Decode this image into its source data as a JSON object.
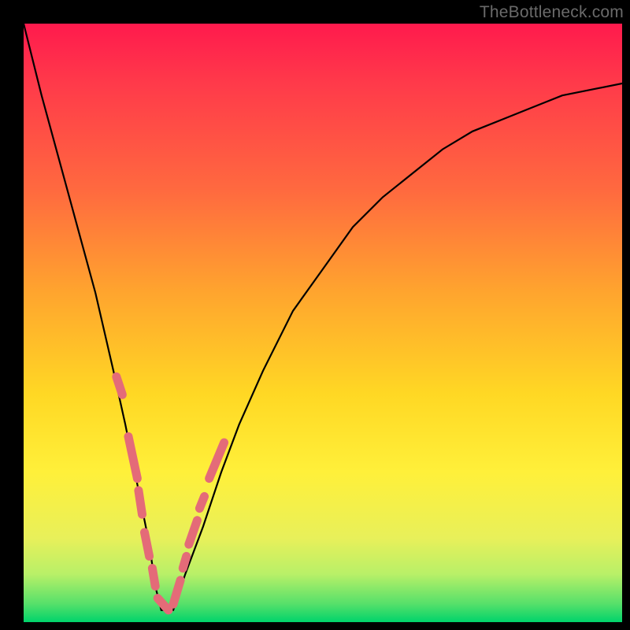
{
  "watermark": "TheBottleneck.com",
  "chart_data": {
    "type": "line",
    "title": "",
    "xlabel": "",
    "ylabel": "",
    "xlim": [
      0,
      100
    ],
    "ylim": [
      0,
      100
    ],
    "grid": false,
    "legend": false,
    "series": [
      {
        "name": "bottleneck-curve",
        "x": [
          0,
          3,
          6,
          9,
          12,
          15,
          17,
          19,
          21,
          22,
          23,
          25,
          27,
          30,
          33,
          36,
          40,
          45,
          50,
          55,
          60,
          65,
          70,
          75,
          80,
          85,
          90,
          95,
          100
        ],
        "y": [
          100,
          88,
          77,
          66,
          55,
          42,
          33,
          23,
          13,
          6,
          2,
          2,
          8,
          16,
          25,
          33,
          42,
          52,
          59,
          66,
          71,
          75,
          79,
          82,
          84,
          86,
          88,
          89,
          90
        ]
      }
    ],
    "markers": {
      "name": "highlighted-range",
      "color": "#e46b78",
      "segments": [
        {
          "x": [
            15.5,
            16.5
          ],
          "y": [
            41,
            38
          ]
        },
        {
          "x": [
            17.5,
            19.0
          ],
          "y": [
            31,
            24
          ]
        },
        {
          "x": [
            19.2,
            19.8
          ],
          "y": [
            22,
            18
          ]
        },
        {
          "x": [
            20.2,
            21.0
          ],
          "y": [
            15,
            11
          ]
        },
        {
          "x": [
            21.5,
            22.0
          ],
          "y": [
            9,
            6
          ]
        },
        {
          "x": [
            22.4,
            24.2
          ],
          "y": [
            4,
            2
          ]
        },
        {
          "x": [
            25.0,
            26.2
          ],
          "y": [
            3,
            7
          ]
        },
        {
          "x": [
            26.6,
            27.2
          ],
          "y": [
            9,
            11
          ]
        },
        {
          "x": [
            27.6,
            29.0
          ],
          "y": [
            13,
            17
          ]
        },
        {
          "x": [
            29.4,
            30.2
          ],
          "y": [
            19,
            21
          ]
        },
        {
          "x": [
            31.0,
            33.5
          ],
          "y": [
            24,
            30
          ]
        }
      ]
    },
    "gradient_bands": [
      {
        "color": "#ff1a4d",
        "from": 100,
        "to": 85
      },
      {
        "color": "#ff6a3f",
        "from": 85,
        "to": 60
      },
      {
        "color": "#ffd824",
        "from": 60,
        "to": 25
      },
      {
        "color": "#e8f05a",
        "from": 25,
        "to": 10
      },
      {
        "color": "#00d36b",
        "from": 10,
        "to": 0
      }
    ]
  }
}
